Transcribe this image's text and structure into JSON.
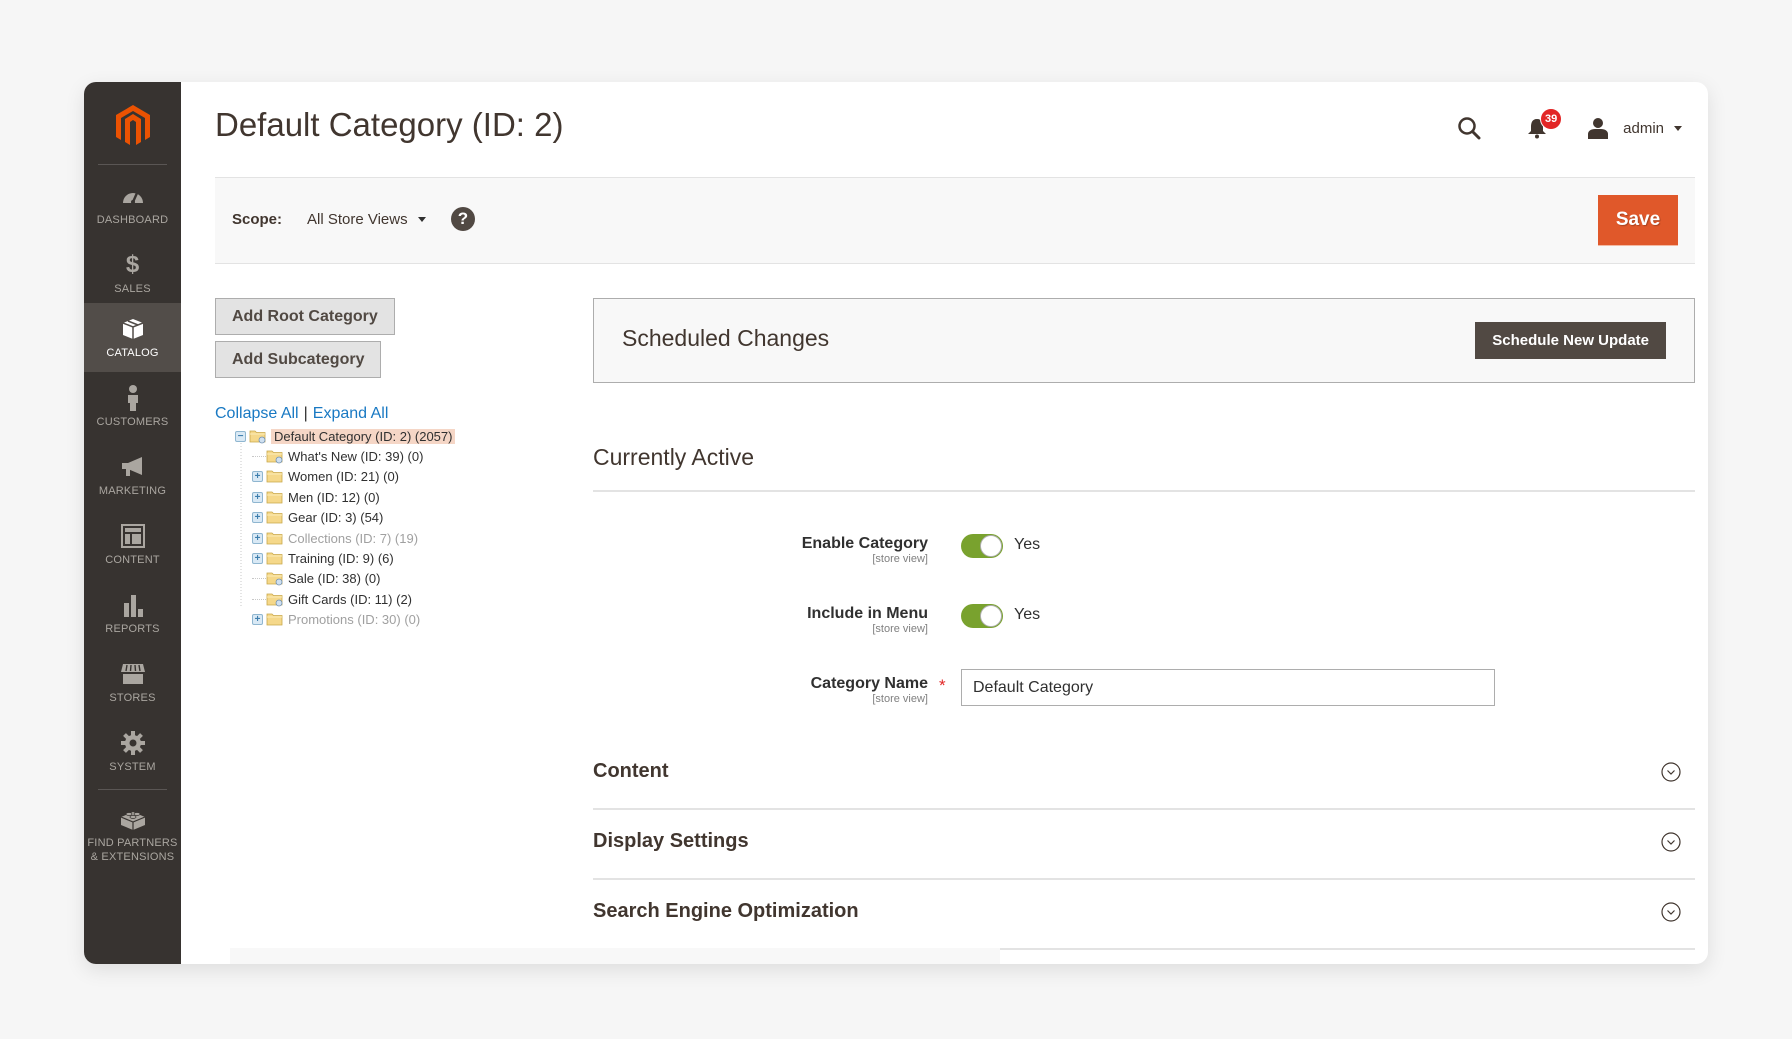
{
  "sidebar": {
    "logo": "magento-logo",
    "items": [
      {
        "label": "DASHBOARD",
        "icon": "dashboard-gauge-icon",
        "active": false
      },
      {
        "label": "SALES",
        "icon": "dollar-icon",
        "active": false
      },
      {
        "label": "CATALOG",
        "icon": "box-icon",
        "active": true
      },
      {
        "label": "CUSTOMERS",
        "icon": "person-icon",
        "active": false
      },
      {
        "label": "MARKETING",
        "icon": "megaphone-icon",
        "active": false
      },
      {
        "label": "CONTENT",
        "icon": "layout-icon",
        "active": false
      },
      {
        "label": "REPORTS",
        "icon": "bar-chart-icon",
        "active": false
      },
      {
        "label": "STORES",
        "icon": "storefront-icon",
        "active": false
      },
      {
        "label": "SYSTEM",
        "icon": "gear-icon",
        "active": false
      }
    ],
    "extra_item": {
      "label_line1": "FIND PARTNERS",
      "label_line2": "& EXTENSIONS",
      "icon": "lego-brick-icon"
    }
  },
  "header": {
    "title": "Default Category (ID: 2)",
    "notifications_count": "39",
    "user_name": "admin"
  },
  "scope_bar": {
    "label": "Scope:",
    "selected": "All Store Views",
    "help": "?",
    "save_label": "Save"
  },
  "tree_panel": {
    "add_root_label": "Add Root Category",
    "add_sub_label": "Add Subcategory",
    "collapse_all": "Collapse All",
    "separator": "|",
    "expand_all": "Expand All",
    "nodes": [
      {
        "label": "Default Category (ID: 2) (2057)",
        "level": 0,
        "toggle": "minus",
        "selected": true,
        "disabled": false,
        "anchor": true
      },
      {
        "label": "What's New (ID: 39) (0)",
        "level": 1,
        "toggle": null,
        "selected": false,
        "disabled": false,
        "anchor": true
      },
      {
        "label": "Women (ID: 21) (0)",
        "level": 1,
        "toggle": "plus",
        "selected": false,
        "disabled": false,
        "anchor": false
      },
      {
        "label": "Men (ID: 12) (0)",
        "level": 1,
        "toggle": "plus",
        "selected": false,
        "disabled": false,
        "anchor": false
      },
      {
        "label": "Gear (ID: 3) (54)",
        "level": 1,
        "toggle": "plus",
        "selected": false,
        "disabled": false,
        "anchor": false
      },
      {
        "label": "Collections (ID: 7) (19)",
        "level": 1,
        "toggle": "plus",
        "selected": false,
        "disabled": true,
        "anchor": false
      },
      {
        "label": "Training (ID: 9) (6)",
        "level": 1,
        "toggle": "plus",
        "selected": false,
        "disabled": false,
        "anchor": false
      },
      {
        "label": "Sale (ID: 38) (0)",
        "level": 1,
        "toggle": null,
        "selected": false,
        "disabled": false,
        "anchor": true
      },
      {
        "label": "Gift Cards (ID: 11) (2)",
        "level": 1,
        "toggle": null,
        "selected": false,
        "disabled": false,
        "anchor": true
      },
      {
        "label": "Promotions (ID: 30) (0)",
        "level": 1,
        "toggle": "plus",
        "selected": false,
        "disabled": true,
        "anchor": false
      }
    ]
  },
  "scheduled": {
    "title": "Scheduled Changes",
    "button_label": "Schedule New Update"
  },
  "currently_active": {
    "title": "Currently Active",
    "fields": {
      "enable_category": {
        "label": "Enable Category",
        "scope": "[store view]",
        "value": "Yes",
        "on": true
      },
      "include_in_menu": {
        "label": "Include in Menu",
        "scope": "[store view]",
        "value": "Yes",
        "on": true
      },
      "category_name": {
        "label": "Category Name",
        "scope": "[store view]",
        "required_mark": "*",
        "value": "Default Category"
      }
    }
  },
  "sections": [
    {
      "title": "Content"
    },
    {
      "title": "Display Settings"
    },
    {
      "title": "Search Engine Optimization"
    }
  ],
  "colors": {
    "accent": "#e0582a",
    "sidebar_bg": "#373330",
    "sidebar_active": "#524d49",
    "toggle_on": "#79a22e",
    "link": "#1979c3",
    "badge": "#e22626"
  }
}
